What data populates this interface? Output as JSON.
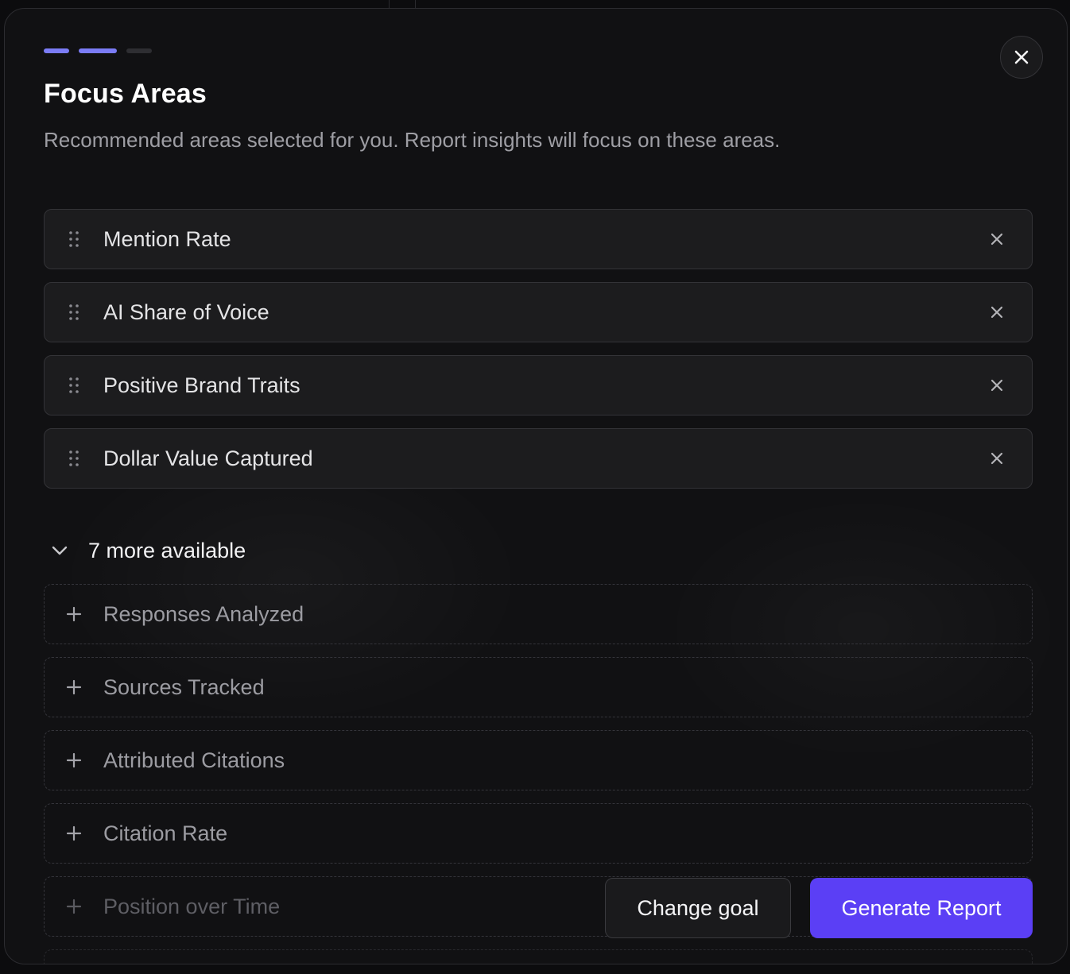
{
  "wizard": {
    "steps": [
      {
        "state": "complete",
        "color": "#7b7cf6"
      },
      {
        "state": "current",
        "color": "#7b7cf6"
      },
      {
        "state": "upcoming",
        "color": "#2e2e32"
      }
    ]
  },
  "header": {
    "title": "Focus Areas",
    "subtitle": "Recommended areas selected for you. Report insights will focus on these areas.",
    "close_icon": "close-icon"
  },
  "selected_areas": [
    {
      "label": "Mention Rate",
      "drag_icon": "drag-handle-icon",
      "remove_icon": "remove-icon"
    },
    {
      "label": "AI Share of Voice",
      "drag_icon": "drag-handle-icon",
      "remove_icon": "remove-icon"
    },
    {
      "label": "Positive Brand Traits",
      "drag_icon": "drag-handle-icon",
      "remove_icon": "remove-icon"
    },
    {
      "label": "Dollar Value Captured",
      "drag_icon": "drag-handle-icon",
      "remove_icon": "remove-icon"
    }
  ],
  "more_toggle": {
    "label": "7 more available",
    "icon": "chevron-down-icon",
    "expanded": true
  },
  "available_areas": [
    {
      "label": "Responses Analyzed",
      "icon": "plus-icon"
    },
    {
      "label": "Sources Tracked",
      "icon": "plus-icon"
    },
    {
      "label": "Attributed Citations",
      "icon": "plus-icon"
    },
    {
      "label": "Citation Rate",
      "icon": "plus-icon"
    },
    {
      "label": "Position over Time",
      "icon": "plus-icon"
    }
  ],
  "footer": {
    "change_goal_label": "Change goal",
    "generate_label": "Generate Report"
  },
  "colors": {
    "accent": "#5b3ff5",
    "progress_active": "#7b7cf6",
    "progress_inactive": "#2e2e32"
  }
}
